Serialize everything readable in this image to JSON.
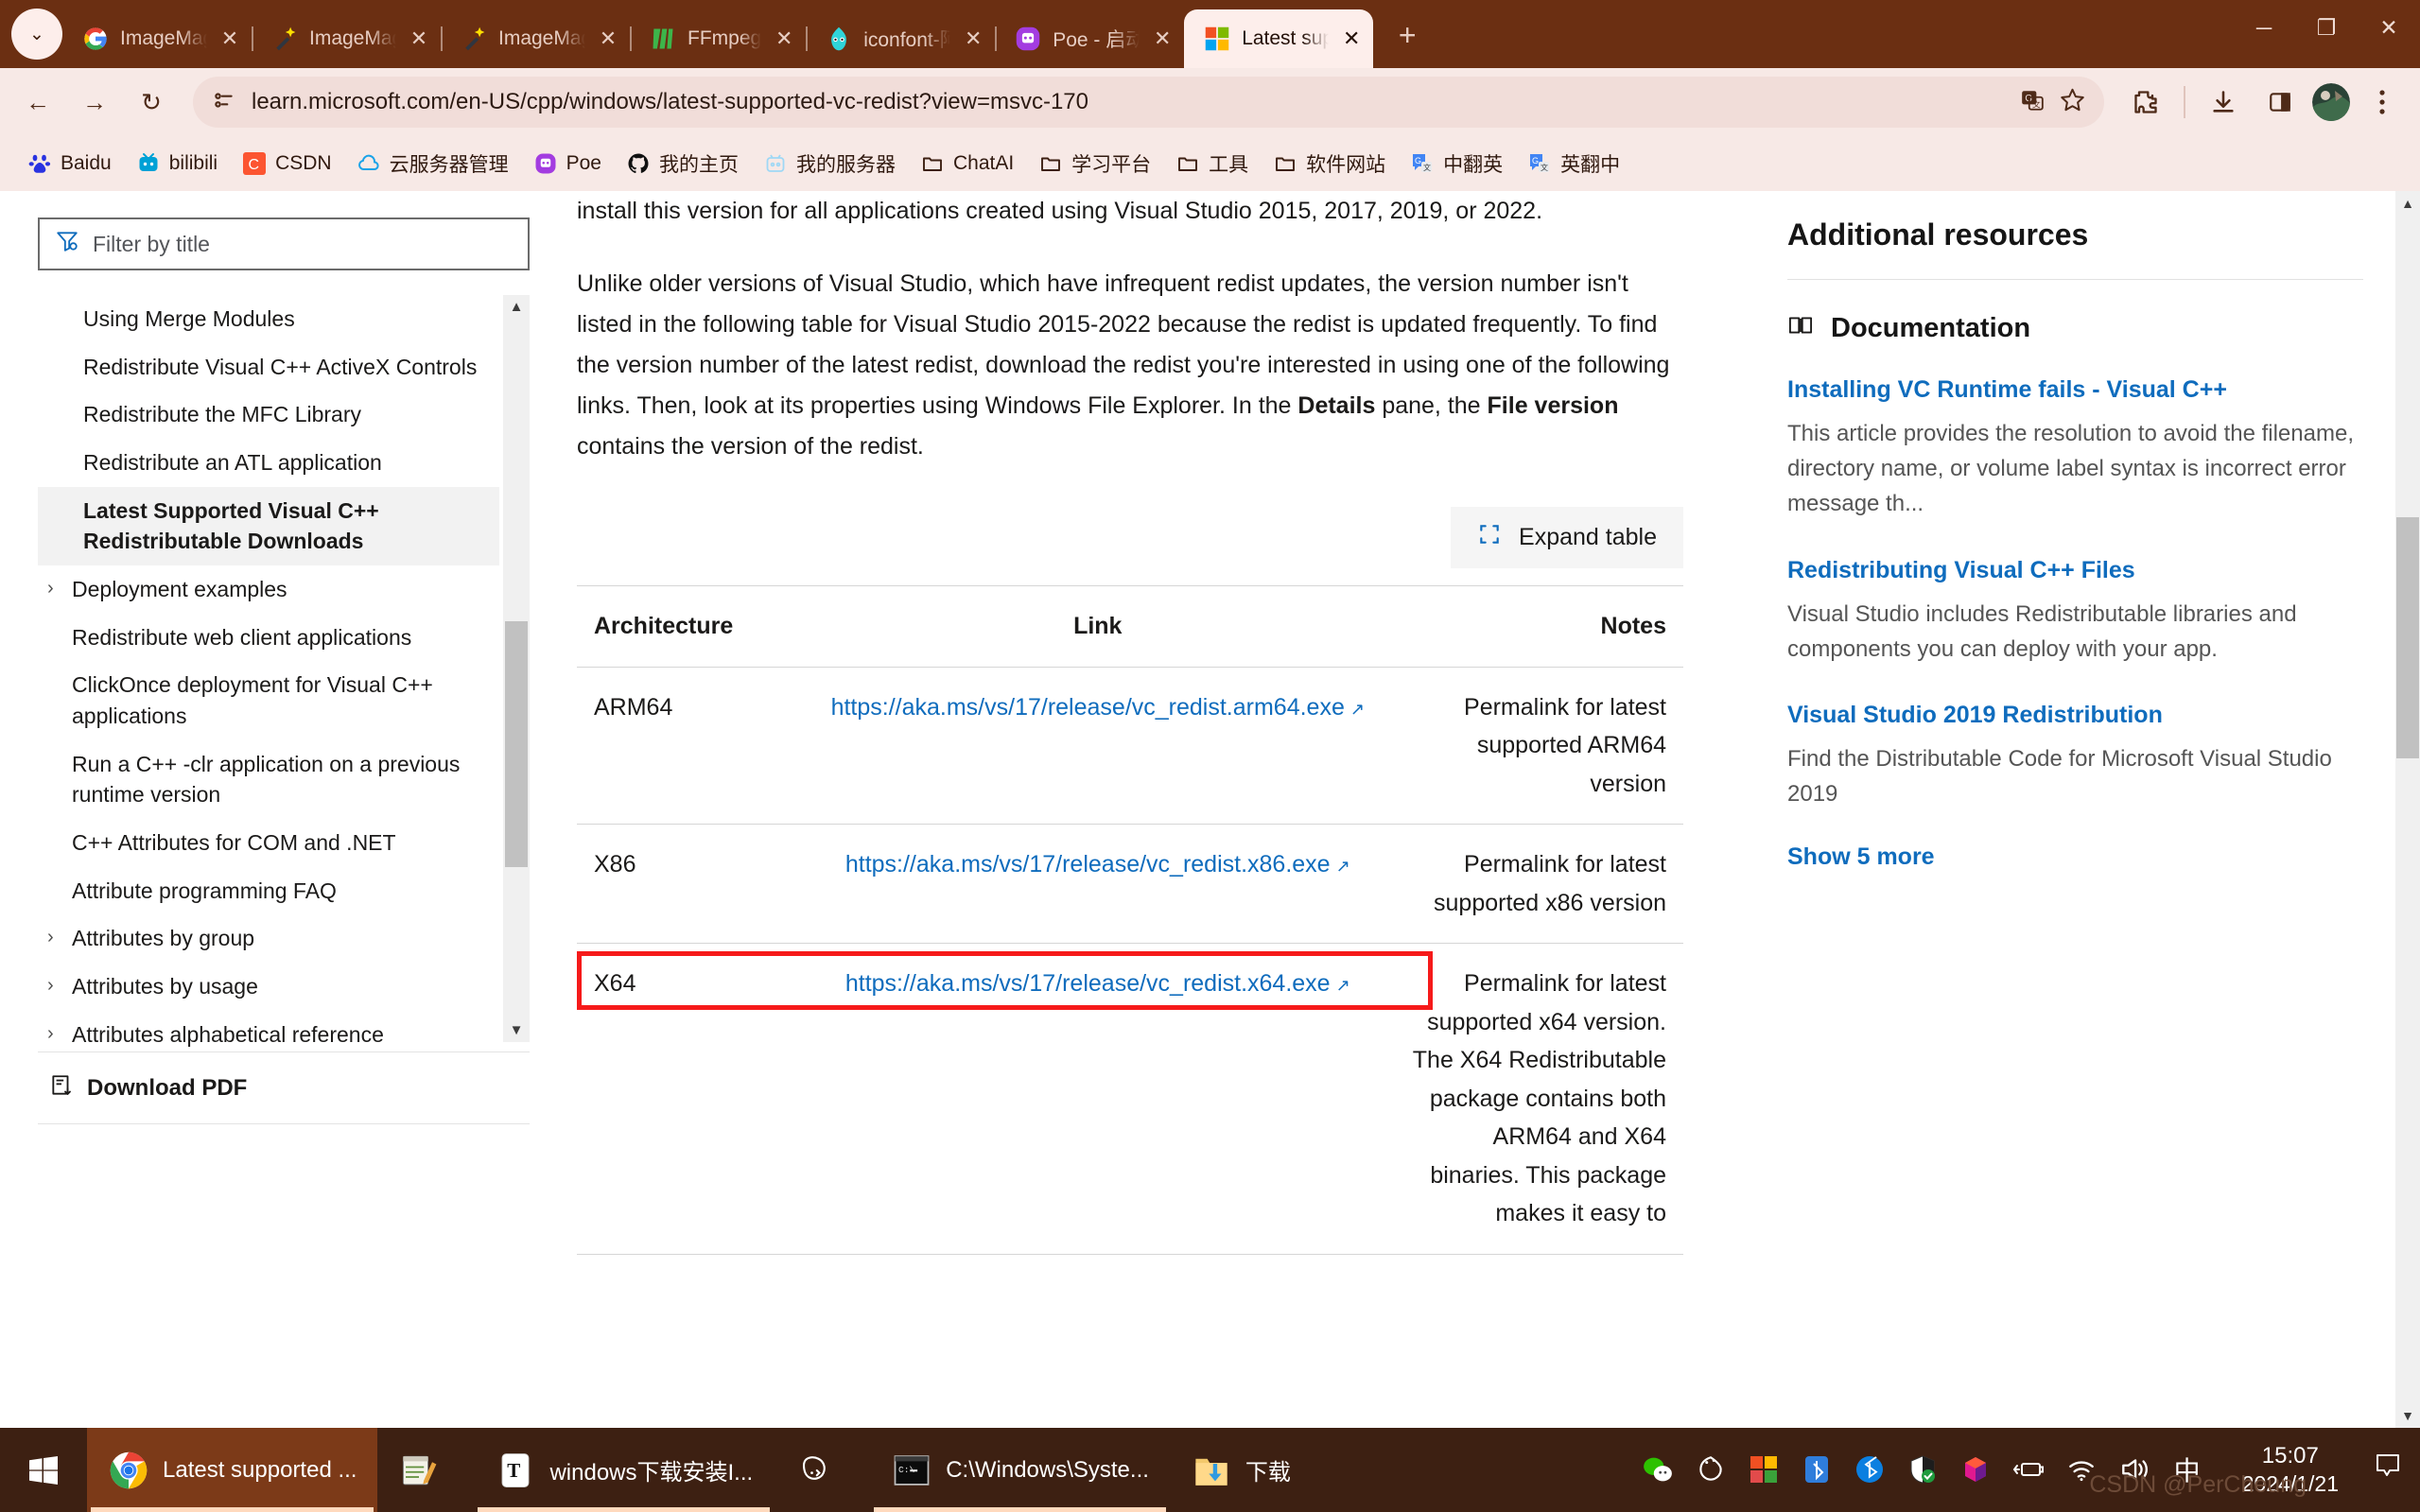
{
  "browser": {
    "tabs": [
      {
        "title": "ImageMagick",
        "icon": "google-icon",
        "active": false
      },
      {
        "title": "ImageMagick",
        "icon": "wand-icon",
        "active": false
      },
      {
        "title": "ImageMagick",
        "icon": "wand-icon",
        "active": false
      },
      {
        "title": "FFmpeg",
        "icon": "ffmpeg-icon",
        "active": false
      },
      {
        "title": "iconfont-阿里",
        "icon": "iconfont-icon",
        "active": false
      },
      {
        "title": "Poe - 启动模",
        "icon": "poe-icon",
        "active": false
      },
      {
        "title": "Latest suppo",
        "icon": "microsoft-icon",
        "active": true
      }
    ],
    "new_tab_label": "+",
    "close_label": "✕",
    "tab_list_label": "⌄",
    "window_controls": {
      "minimize": "─",
      "maximize": "❐",
      "close": "✕"
    },
    "nav": {
      "back": "←",
      "forward": "→",
      "reload": "↻",
      "url": "learn.microsoft.com/en-US/cpp/windows/latest-supported-vc-redist?view=msvc-170",
      "site_info_icon": "page-info-icon",
      "translate_icon": "translate-icon",
      "bookmark_icon": "star-icon",
      "extensions_icon": "puzzle-icon",
      "downloads_icon": "download-icon",
      "sidepanel_icon": "side-panel-icon",
      "profile_icon": "avatar-icon",
      "menu_icon": "three-dot-menu-icon"
    },
    "bookmarks": [
      {
        "label": "Baidu",
        "icon": "baidu-icon"
      },
      {
        "label": "bilibili",
        "icon": "bilibili-icon"
      },
      {
        "label": "CSDN",
        "icon": "csdn-icon"
      },
      {
        "label": "云服务器管理",
        "icon": "cloud-icon"
      },
      {
        "label": "Poe",
        "icon": "poe-icon"
      },
      {
        "label": "我的主页",
        "icon": "github-icon"
      },
      {
        "label": "我的服务器",
        "icon": "server-icon"
      },
      {
        "label": "ChatAI",
        "icon": "folder-icon"
      },
      {
        "label": "学习平台",
        "icon": "folder-icon"
      },
      {
        "label": "工具",
        "icon": "folder-icon"
      },
      {
        "label": "软件网站",
        "icon": "folder-icon"
      },
      {
        "label": "中翻英",
        "icon": "google-translate-icon"
      },
      {
        "label": "英翻中",
        "icon": "google-translate-icon"
      }
    ]
  },
  "toc": {
    "filter_placeholder": "Filter by title",
    "filter_icon": "filter-icon",
    "items": [
      {
        "label": "Using Merge Modules",
        "caret": false,
        "active": false
      },
      {
        "label": "Redistribute Visual C++ ActiveX Controls",
        "caret": false,
        "active": false
      },
      {
        "label": "Redistribute the MFC Library",
        "caret": false,
        "active": false
      },
      {
        "label": "Redistribute an ATL application",
        "caret": false,
        "active": false
      },
      {
        "label": "Latest Supported Visual C++ Redistributable Downloads",
        "caret": false,
        "active": true
      },
      {
        "label": "Deployment examples",
        "caret": true,
        "active": false
      },
      {
        "label": "Redistribute web client applications",
        "caret": false,
        "active": false
      },
      {
        "label": "ClickOnce deployment for Visual C++ applications",
        "caret": false,
        "active": false
      },
      {
        "label": "Run a C++ -clr application on a previous runtime version",
        "caret": false,
        "active": false
      },
      {
        "label": "C++ Attributes for COM and .NET",
        "caret": false,
        "active": false
      },
      {
        "label": "Attribute programming FAQ",
        "caret": false,
        "active": false
      },
      {
        "label": "Attributes by group",
        "caret": true,
        "active": false
      },
      {
        "label": "Attributes by usage",
        "caret": true,
        "active": false
      },
      {
        "label": "Attributes alphabetical reference",
        "caret": true,
        "active": false
      }
    ],
    "download_pdf": "Download PDF",
    "download_pdf_icon": "pdf-download-icon"
  },
  "article": {
    "paragraph1": "install this version for all applications created using Visual Studio 2015, 2017, 2019, or 2022.",
    "paragraph2_a": "Unlike older versions of Visual Studio, which have infrequent redist updates, the version number isn't listed in the following table for Visual Studio 2015-2022 because the redist is updated frequently. To find the version number of the latest redist, download the redist you're interested in using one of the following links. Then, look at its properties using Windows File Explorer. In the ",
    "paragraph2_bold1": "Details",
    "paragraph2_b": " pane, the ",
    "paragraph2_bold2": "File version",
    "paragraph2_c": " contains the version of the redist.",
    "expand_table_label": "Expand table",
    "expand_table_icon": "expand-icon",
    "table": {
      "headers": [
        "Architecture",
        "Link",
        "Notes"
      ],
      "rows": [
        {
          "architecture": "ARM64",
          "link": "https://aka.ms/vs/17/release/vc_redist.arm64.exe",
          "notes": "Permalink for latest supported ARM64 version",
          "highlighted": false
        },
        {
          "architecture": "X86",
          "link": "https://aka.ms/vs/17/release/vc_redist.x86.exe",
          "notes": "Permalink for latest supported x86 version",
          "highlighted": false
        },
        {
          "architecture": "X64",
          "link": "https://aka.ms/vs/17/release/vc_redist.x64.exe",
          "notes": "Permalink for latest supported x64 version. The X64 Redistributable package contains both ARM64 and X64 binaries. This package makes it easy to",
          "highlighted": true
        }
      ],
      "external_link_icon": "external-link-icon",
      "highlight_color": "#f61a1a"
    }
  },
  "rail": {
    "title": "Additional resources",
    "section_label": "Documentation",
    "section_icon": "book-icon",
    "links": [
      {
        "title": "Installing VC Runtime fails - Visual C++",
        "desc": "This article provides the resolution to avoid the filename, directory name, or volume label syntax is incorrect error message th..."
      },
      {
        "title": "Redistributing Visual C++ Files",
        "desc": "Visual Studio includes Redistributable libraries and components you can deploy with your app."
      },
      {
        "title": "Visual Studio 2019 Redistribution",
        "desc": "Find the Distributable Code for Microsoft Visual Studio 2019"
      }
    ],
    "show_more": "Show 5 more",
    "link_color": "#0f6cbd"
  },
  "taskbar": {
    "start_icon": "windows-start-icon",
    "items": [
      {
        "label": "Latest supported ...",
        "icon": "chrome-icon",
        "active": true
      },
      {
        "label": "",
        "icon": "notepad-icon",
        "active": false
      },
      {
        "label": "windows下载安装I...",
        "icon": "typora-icon",
        "active": false
      },
      {
        "label": "",
        "icon": "pig-icon",
        "active": false
      },
      {
        "label": "C:\\Windows\\Syste...",
        "icon": "cmd-icon",
        "active": false
      },
      {
        "label": "下载",
        "icon": "downloads-folder-icon",
        "active": false
      }
    ],
    "tray_icons": [
      "wechat-icon",
      "qq-music-icon",
      "microsoft-icon",
      "bluetooth-app-icon",
      "bluetooth-icon",
      "defender-icon",
      "colorful-cube-icon",
      "battery-charging-icon",
      "wifi-icon",
      "volume-icon",
      "ime-chinese-icon"
    ],
    "ime_label": "中",
    "clock_time": "15:07",
    "clock_date": "2024/1/21",
    "notification_icon": "notification-icon",
    "watermark": "CSDN @PerCheung"
  }
}
